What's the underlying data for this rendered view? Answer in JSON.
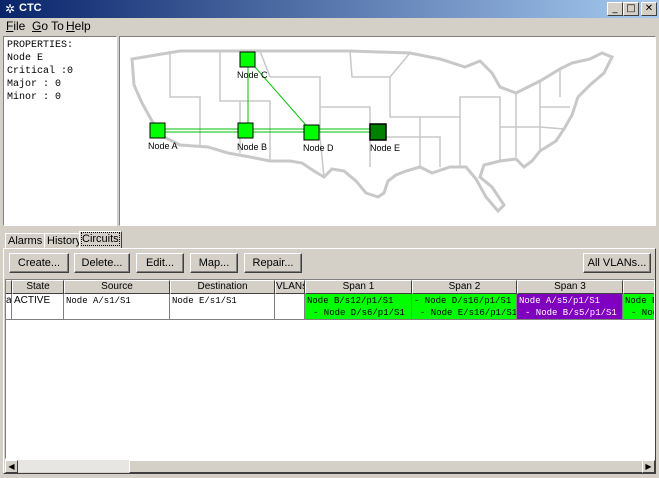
{
  "window": {
    "title": "CTC",
    "minimize": "_",
    "maximize": "□",
    "close": "✕"
  },
  "menu": [
    {
      "prefix": "",
      "underline": "F",
      "rest": "ile"
    },
    {
      "prefix": "",
      "underline": "G",
      "rest": "o To"
    },
    {
      "prefix": "",
      "underline": "H",
      "rest": "elp"
    }
  ],
  "properties": {
    "heading": "PROPERTIES:",
    "node": "Node E",
    "critical": "Critical :0",
    "major": "Major : 0",
    "minor": "Minor : 0"
  },
  "map": {
    "node_color": "#00ff00",
    "selected_node_color": "#008000",
    "nodes": [
      {
        "label": "Node A",
        "selected": false
      },
      {
        "label": "Node B",
        "selected": false
      },
      {
        "label": "Node C",
        "selected": false
      },
      {
        "label": "Node D",
        "selected": false
      },
      {
        "label": "Node E",
        "selected": true
      }
    ]
  },
  "tabs": [
    "Alarms",
    "History",
    "Circuits"
  ],
  "active_tab": "Circuits",
  "toolbar": {
    "create": "Create...",
    "delete": "Delete...",
    "edit": "Edit...",
    "map": "Map...",
    "repair": "Repair...",
    "all_vlans": "All VLANs..."
  },
  "table": {
    "headers": [
      "",
      "State",
      "Source",
      "Destination",
      "VLANs",
      "Span 1",
      "Span 2",
      "Span 3",
      ""
    ],
    "row": {
      "type": "ay",
      "state": "ACTIVE",
      "source": "Node A/s1/S1",
      "destination": "Node E/s1/S1",
      "vlans": "",
      "span1_a": "Node B/s12/p1/S1",
      "span1_b": "- Node D/s6/p1/S1",
      "span2_a": "- Node D/s16/p1/S1",
      "span2_b": "- Node E/s16/p1/S1",
      "span3_a": "Node A/s5/p1/S1",
      "span3_b": "- Node B/s5/p1/S1",
      "span4_a": "Node B",
      "span4_b": "- Node"
    }
  },
  "colors": {
    "span_green": "#00ff00",
    "span_purple": "#8000c0"
  }
}
